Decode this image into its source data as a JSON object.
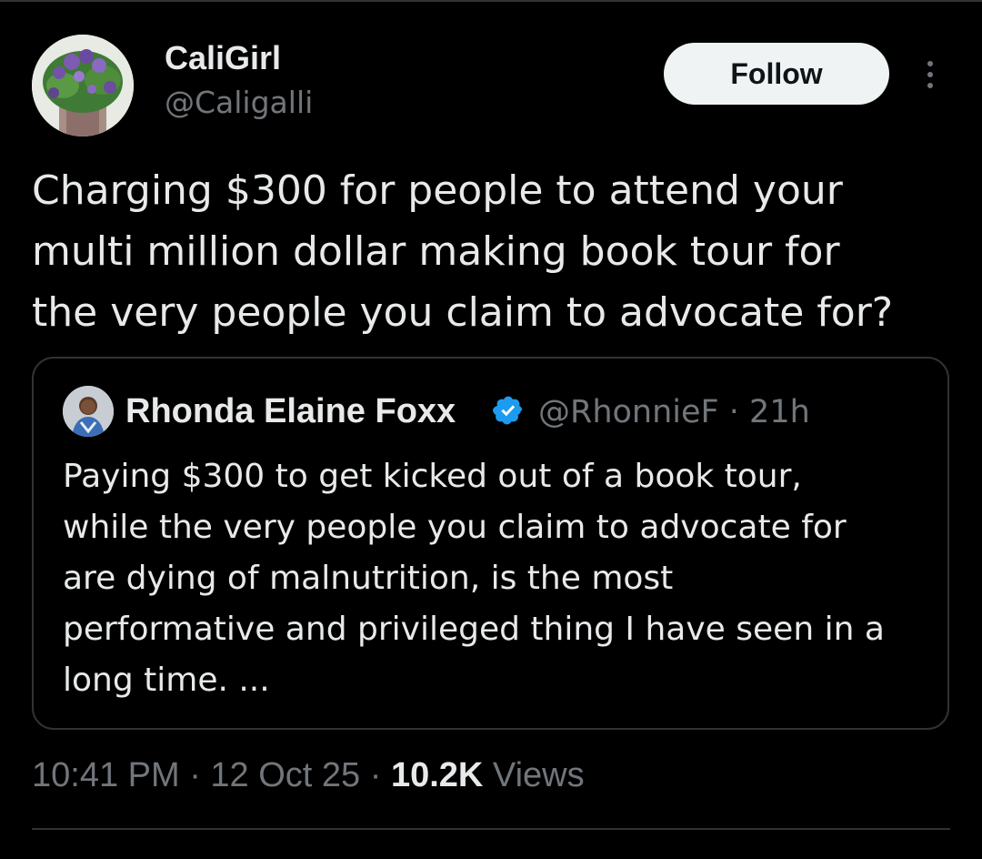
{
  "author": {
    "display_name": "CaliGirl",
    "handle": "@Caligalli",
    "avatar_icon": "flower-bouquet-avatar"
  },
  "actions": {
    "follow_label": "Follow",
    "more_icon": "more-options-icon"
  },
  "tweet": {
    "text_lines": [
      "Charging $300 for people to attend your",
      "multi million dollar making book tour for",
      "the very people you claim to advocate for?"
    ]
  },
  "quoted_tweet": {
    "display_name": "Rhonda Elaine Foxx",
    "verified_icon": "verified-badge-icon",
    "handle_time": "@RhonnieF · 21h",
    "text_lines": [
      "Paying $300 to get kicked out of a book tour,",
      "while the very people you claim to advocate for",
      "are dying of malnutrition, is the most",
      "performative and privileged thing I have seen in a",
      "long time. ..."
    ]
  },
  "meta": {
    "time_date": "10:41 PM · 12 Oct 25 · ",
    "views_count": "10.2K",
    "views_label": " Views"
  },
  "colors": {
    "background": "#000000",
    "primary_text": "#e7e9ea",
    "secondary_text": "#71767b",
    "border": "#2f3336",
    "verified": "#1d9bf0",
    "follow_button_bg": "#eff3f4"
  }
}
